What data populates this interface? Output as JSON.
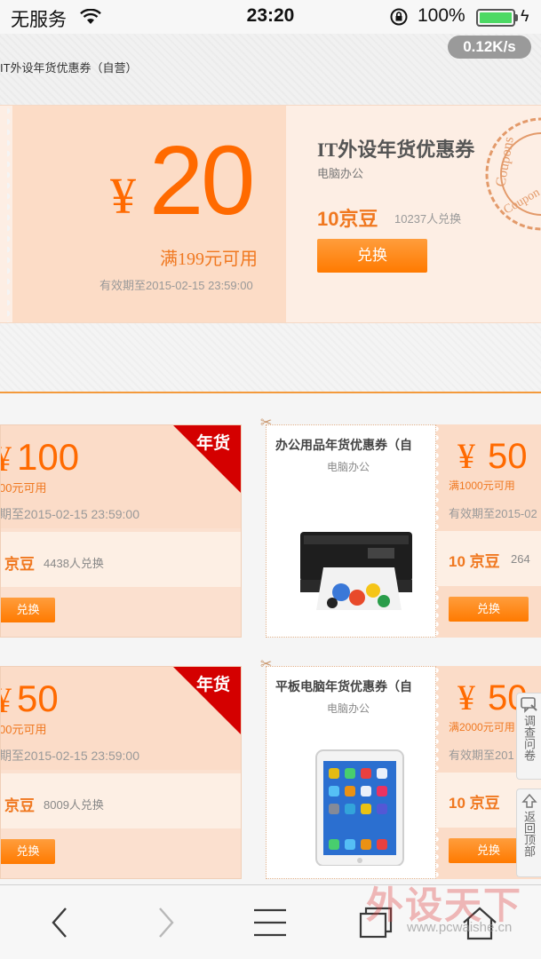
{
  "status_bar": {
    "carrier": "无服务",
    "time": "23:20",
    "battery_percent": "100%",
    "battery_level": 1.0
  },
  "page": {
    "title": "IT外设年货优惠券（自营）",
    "speed_badge": "0.12K/s"
  },
  "hero_coupon": {
    "currency": "¥",
    "amount": "20",
    "condition": "满199元可用",
    "expiry": "有效期至2015-02-15 23:59:00",
    "title": "IT外设年货优惠券",
    "category": "电脑办公",
    "points": "10京豆",
    "redeem_count": "10237人兑换",
    "button": "兑换"
  },
  "cards": [
    {
      "currency": "¥",
      "amount": "100",
      "condition": "00元可用",
      "expiry": "期至2015-02-15 23:59:00",
      "points": "京豆",
      "redeem_count": "4438人兑换",
      "button": "兑换",
      "ribbon": "年货"
    },
    {
      "currency": "¥",
      "amount": "50",
      "condition": "00元可用",
      "expiry": "期至2015-02-15 23:59:00",
      "points": "京豆",
      "redeem_count": "8009人兑换",
      "button": "兑换",
      "ribbon": "年货"
    }
  ],
  "products": [
    {
      "title": "办公用品年货优惠券（自",
      "category": "电脑办公",
      "currency": "¥",
      "amount": "50",
      "condition": "满1000元可用",
      "expiry": "有效期至2015-02",
      "points": "10 京豆",
      "redeem_count": "264",
      "button": "兑换",
      "image": "printer"
    },
    {
      "title": "平板电脑年货优惠券（自",
      "category": "电脑办公",
      "currency": "¥",
      "amount": "50",
      "condition": "满2000元可用",
      "expiry": "有效期至201",
      "points": "10 京豆",
      "redeem_count": "",
      "button": "兑换",
      "image": "tablet"
    }
  ],
  "float_tools": {
    "survey": "调查问卷",
    "back_to_top": "返回顶部"
  },
  "watermark": {
    "brand": "外设天下",
    "url": "www.pcwaishe.cn"
  },
  "toolbar": {
    "icons": [
      "back-icon",
      "forward-icon",
      "menu-icon",
      "tabs-icon",
      "home-icon"
    ]
  },
  "colors": {
    "accent": "#ff6a00",
    "coupon_bg": "#fbdcc8",
    "button": "#ff8a1c",
    "ribbon": "#d40000"
  }
}
